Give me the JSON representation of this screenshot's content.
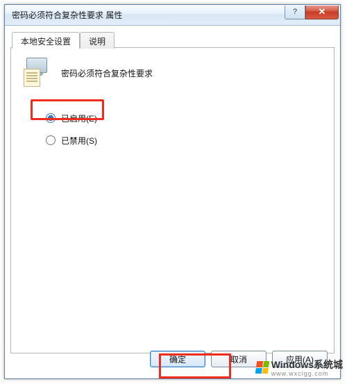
{
  "window": {
    "title": "密码必须符合复杂性要求 属性",
    "help_glyph": "?",
    "close_glyph": "✕"
  },
  "tabs": {
    "local": "本地安全设置",
    "explain": "说明"
  },
  "policy": {
    "name": "密码必须符合复杂性要求"
  },
  "options": {
    "enabled": "已启用(E)",
    "disabled": "已禁用(S)",
    "selected": "enabled"
  },
  "buttons": {
    "ok": "确定",
    "cancel": "取消",
    "apply": "应用(A)"
  },
  "watermark": {
    "brand": "Windows系统城",
    "url": "www.wxclgg.com"
  }
}
